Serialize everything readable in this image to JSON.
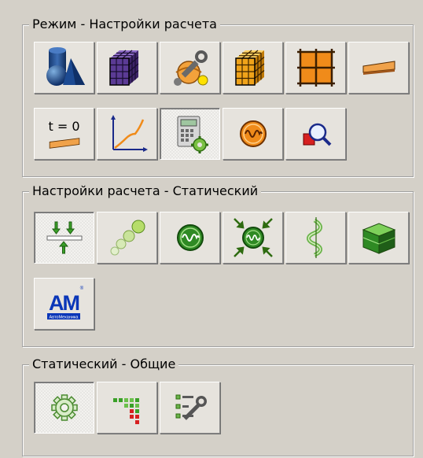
{
  "groups": {
    "mode": {
      "title": "Режим - Настройки расчета"
    },
    "calc": {
      "title": "Настройки расчета - Статический"
    },
    "static": {
      "title": "Статический - Общие"
    }
  },
  "icons": {
    "t0_label": "t = 0",
    "apm_logo_letters": "АМ",
    "apm_logo_caption": "АвтоМеханика",
    "apm_logo_mark": "®"
  }
}
